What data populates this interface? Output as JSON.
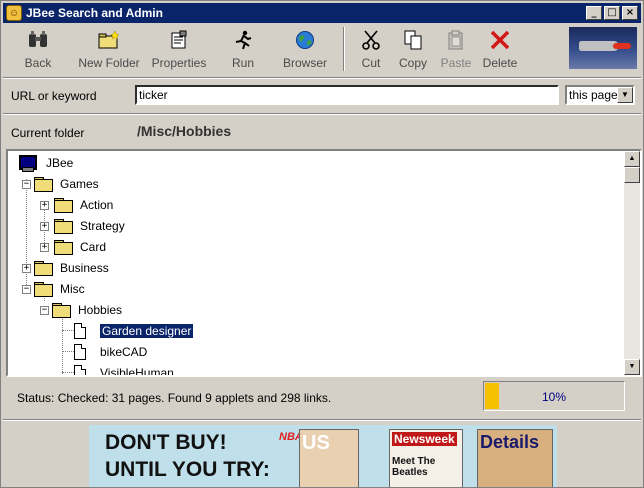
{
  "window": {
    "title": "JBee Search and Admin",
    "controls": [
      "_",
      "□",
      "×"
    ]
  },
  "toolbar": {
    "buttons": [
      {
        "label": "Back",
        "icon": "binoculars-icon"
      },
      {
        "label": "New Folder",
        "icon": "new-folder-icon"
      },
      {
        "label": "Properties",
        "icon": "properties-icon"
      },
      {
        "label": "Run",
        "icon": "run-icon"
      },
      {
        "label": "Browser",
        "icon": "globe-icon"
      },
      {
        "label": "Cut",
        "icon": "scissors-icon"
      },
      {
        "label": "Copy",
        "icon": "copy-icon"
      },
      {
        "label": "Paste",
        "icon": "paste-icon",
        "disabled": true
      },
      {
        "label": "Delete",
        "icon": "delete-icon"
      }
    ]
  },
  "search": {
    "label": "URL or keyword",
    "value": "ticker",
    "scope": "this page"
  },
  "folder": {
    "label": "Current folder",
    "path": "/Misc/Hobbies"
  },
  "tree": {
    "nodes": [
      {
        "label": "JBee",
        "type": "root"
      },
      {
        "label": "Games",
        "type": "folder",
        "expanded": true
      },
      {
        "label": "Action",
        "type": "folder",
        "expanded": false
      },
      {
        "label": "Strategy",
        "type": "folder",
        "expanded": false
      },
      {
        "label": "Card",
        "type": "folder",
        "expanded": false
      },
      {
        "label": "Business",
        "type": "folder",
        "expanded": false
      },
      {
        "label": "Misc",
        "type": "folder",
        "expanded": true
      },
      {
        "label": "Hobbies",
        "type": "folder",
        "expanded": true
      },
      {
        "label": "Garden designer",
        "type": "document",
        "selected": true
      },
      {
        "label": "bikeCAD",
        "type": "document"
      },
      {
        "label": "VisibleHuman",
        "type": "document"
      }
    ]
  },
  "status": {
    "label": "Status:",
    "text": "Checked: 31 pages. Found 9 applets and 298 links."
  },
  "progress": {
    "value": 0.1,
    "label": "10%"
  },
  "banner": {
    "line1": "DON'T BUY!",
    "line2": "UNTIL YOU TRY:",
    "brand": "NBAF",
    "magazines": [
      "US",
      "Newsweek",
      "Meet The Beatles",
      "Details"
    ]
  }
}
